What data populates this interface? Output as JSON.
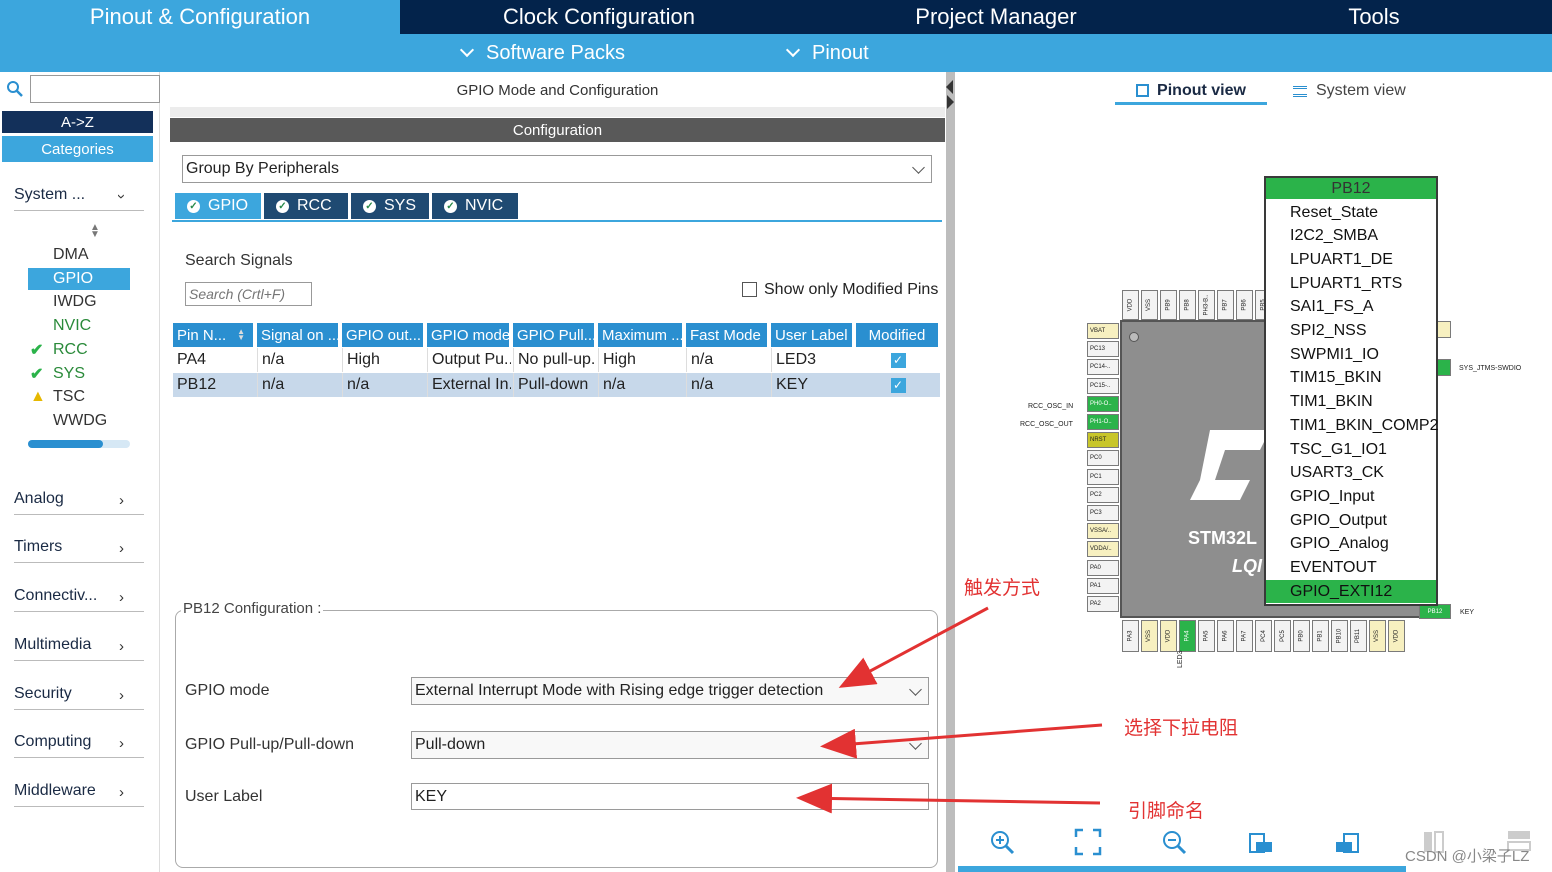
{
  "top_tabs": [
    "Pinout & Configuration",
    "Clock Configuration",
    "Project Manager",
    "Tools"
  ],
  "sub_tabs": [
    "Software Packs",
    "Pinout"
  ],
  "left": {
    "sort_az": "A->Z",
    "categories": "Categories",
    "system_label": "System ...",
    "system_items": [
      {
        "label": "DMA",
        "status": "none",
        "color": "#333333"
      },
      {
        "label": "GPIO",
        "status": "selected",
        "color": "#1a2a44"
      },
      {
        "label": "IWDG",
        "status": "none",
        "color": "#333333"
      },
      {
        "label": "NVIC",
        "status": "none",
        "color": "#2a8a3a"
      },
      {
        "label": "RCC",
        "status": "ok",
        "color": "#2a8a3a"
      },
      {
        "label": "SYS",
        "status": "ok",
        "color": "#2a8a3a"
      },
      {
        "label": "TSC",
        "status": "warn",
        "color": "#333333"
      },
      {
        "label": "WWDG",
        "status": "none",
        "color": "#333333"
      }
    ],
    "categories_list": [
      "Analog",
      "Timers",
      "Connectiv...",
      "Multimedia",
      "Security",
      "Computing",
      "Middleware"
    ]
  },
  "middle": {
    "header": "GPIO Mode and Configuration",
    "config_title": "Configuration",
    "group_by": "Group By Peripherals",
    "tabs": [
      "GPIO",
      "RCC",
      "SYS",
      "NVIC"
    ],
    "search_label": "Search Signals",
    "search_placeholder": "Search (Crtl+F)",
    "show_modified": "Show only Modified Pins",
    "columns": [
      "Pin N...",
      "Signal on ...",
      "GPIO out...",
      "GPIO mode",
      "GPIO Pull...",
      "Maximum ...",
      "Fast Mode",
      "User Label",
      "Modified"
    ],
    "rows": [
      [
        "PA4",
        "n/a",
        "High",
        "Output Pu...",
        "No pull-up...",
        "High",
        "n/a",
        "LED3",
        "✓"
      ],
      [
        "PB12",
        "n/a",
        "n/a",
        "External In...",
        "Pull-down",
        "n/a",
        "n/a",
        "KEY",
        "✓"
      ]
    ],
    "pb12_title": "PB12 Configuration :",
    "fields": [
      {
        "label": "GPIO mode",
        "value": "External Interrupt Mode with Rising edge trigger detection"
      },
      {
        "label": "GPIO Pull-up/Pull-down",
        "value": "Pull-down"
      },
      {
        "label": "User Label",
        "value": "KEY"
      }
    ]
  },
  "right": {
    "view_tabs": [
      "Pinout view",
      "System view"
    ],
    "chip_name": "STM32L",
    "chip_pkg": "LQI",
    "pin_menu_title": "PB12",
    "pin_menu_items": [
      "Reset_State",
      "I2C2_SMBA",
      "LPUART1_DE",
      "LPUART1_RTS",
      "SAI1_FS_A",
      "SPI2_NSS",
      "SWPMI1_IO",
      "TIM15_BKIN",
      "TIM1_BKIN",
      "TIM1_BKIN_COMP2",
      "TSC_G1_IO1",
      "USART3_CK",
      "GPIO_Input",
      "GPIO_Output",
      "GPIO_Analog",
      "EVENTOUT",
      "GPIO_EXTI12"
    ],
    "top_pins": [
      "VDD",
      "VSS",
      "PB9",
      "PB8",
      "PH3-B..",
      "PB7",
      "PB6",
      "PB5"
    ],
    "left_pins": [
      "VBAT",
      "PC13",
      "PC14-..",
      "PC15-..",
      "PH0-O..",
      "PH1-O..",
      "NRST",
      "PC0",
      "PC1",
      "PC2",
      "PC3",
      "VSSA/..",
      "VDDA/..",
      "PA0",
      "PA1",
      "PA2"
    ],
    "bottom_pins": [
      "PA3",
      "VSS",
      "VDD",
      "PA4",
      "PA5",
      "PA6",
      "PA7",
      "PC4",
      "PC5",
      "PB0",
      "PB1",
      "PB10",
      "PB11",
      "VSS",
      "VDD"
    ],
    "pin_labels": {
      "rcc_in": "RCC_OSC_IN",
      "rcc_out": "RCC_OSC_OUT",
      "sys_swdio": "SYS_JTMS-SWDIO",
      "key": "KEY",
      "led3": "LED3",
      "pb12": "PB12"
    },
    "watermark": "CSDN @小梁子LZ"
  },
  "annotations": [
    "触发方式",
    "选择下拉电阻",
    "引脚命名"
  ],
  "colors": {
    "nav_dark": "#03234b",
    "accent": "#3ca6dd",
    "header_blue": "#2a8fd0",
    "pin_green": "#2bb34a",
    "annot_red": "#e23232"
  }
}
